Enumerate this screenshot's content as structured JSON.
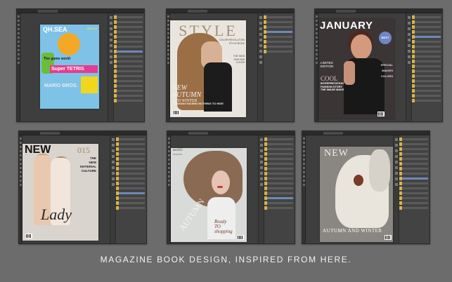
{
  "caption": "MAGAZINE BOOK DESIGN, INSPIRED FROM HERE.",
  "colors": {
    "background": "#6c6c6c",
    "editor_dark": "#3a3a3a",
    "layer_selected": "#6e89b8"
  },
  "covers": [
    {
      "masthead": "QH.SEA",
      "date": "2013.11",
      "lines": [
        "The game world",
        "Super TETRIS",
        "MARIO BROS."
      ]
    },
    {
      "masthead": "STYLE",
      "side_lines": [
        "COLOR REVOLUTION",
        "STYLE BOOK"
      ],
      "side_lines_2": [
        "THE NEW",
        "FASHION",
        "COLOR"
      ],
      "headline": [
        "NEW",
        "AUTUMN",
        "AND WINTER"
      ],
      "subline": "MAKING HAUING NOTHING TO HIDE"
    },
    {
      "masthead": "JANUARY",
      "badge": "BEST",
      "limited": [
        "LIMITED",
        "EDITION"
      ],
      "cool": "COOL",
      "interpretation": [
        "INTERPRETATION",
        "FASHION STORY",
        "THE IMAGE MAKE"
      ],
      "right_items": [
        "SPECIAL",
        "IMAGES",
        "COLORS"
      ]
    },
    {
      "masthead": "NEW",
      "number": "015",
      "side_lines": [
        "THE",
        "NEW",
        "MATERIAL",
        "CULTURE"
      ],
      "script": "Lady"
    },
    {
      "number": "no.015",
      "sub": "FASHION",
      "diagonal": "AUTUMN",
      "script": [
        "Ready",
        "TO",
        "shopping"
      ]
    },
    {
      "masthead": "NEW",
      "bottom": "AUTUMN AND WINTER"
    }
  ]
}
